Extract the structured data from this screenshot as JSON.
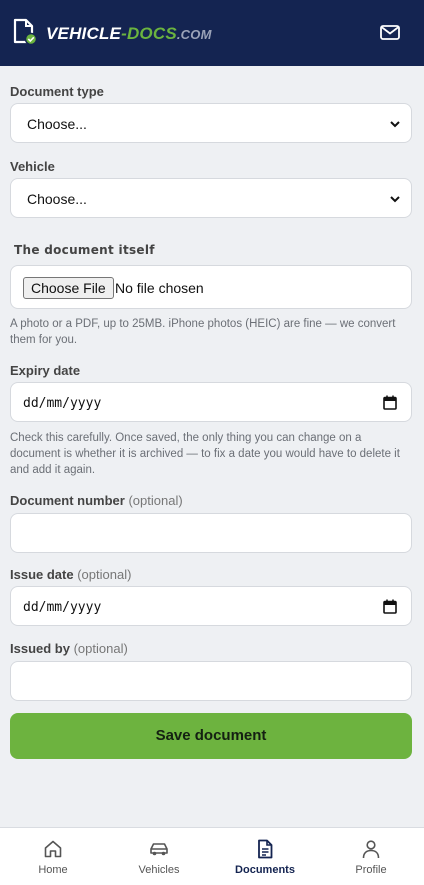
{
  "brand": {
    "part1": "VEHICLE",
    "part2": "-DOCS",
    "part3": ".COM"
  },
  "form": {
    "document_type": {
      "label": "Document type",
      "selected": "Choose..."
    },
    "vehicle": {
      "label": "Vehicle",
      "selected": "Choose..."
    },
    "file": {
      "label": "The document itself",
      "button": "Choose File",
      "status": "No file chosen",
      "help": "A photo or a PDF, up to 25MB. iPhone photos (HEIC) are fine — we convert them for you."
    },
    "expiry": {
      "label": "Expiry date",
      "value": "dd/mm/yyyy",
      "help": "Check this carefully. Once saved, the only thing you can change on a document is whether it is archived — to fix a date you would have to delete it and add it again."
    },
    "doc_number": {
      "label": "Document number",
      "optional": "(optional)"
    },
    "issue_date": {
      "label": "Issue date",
      "optional": "(optional)",
      "value": "dd/mm/yyyy"
    },
    "issued_by": {
      "label": "Issued by",
      "optional": "(optional)"
    },
    "save": "Save document"
  },
  "nav": [
    {
      "label": "Home",
      "icon": "home-icon"
    },
    {
      "label": "Vehicles",
      "icon": "car-icon"
    },
    {
      "label": "Documents",
      "icon": "document-icon",
      "active": true
    },
    {
      "label": "Profile",
      "icon": "user-icon"
    }
  ],
  "colors": {
    "header": "#142451",
    "accent": "#6db33f"
  }
}
